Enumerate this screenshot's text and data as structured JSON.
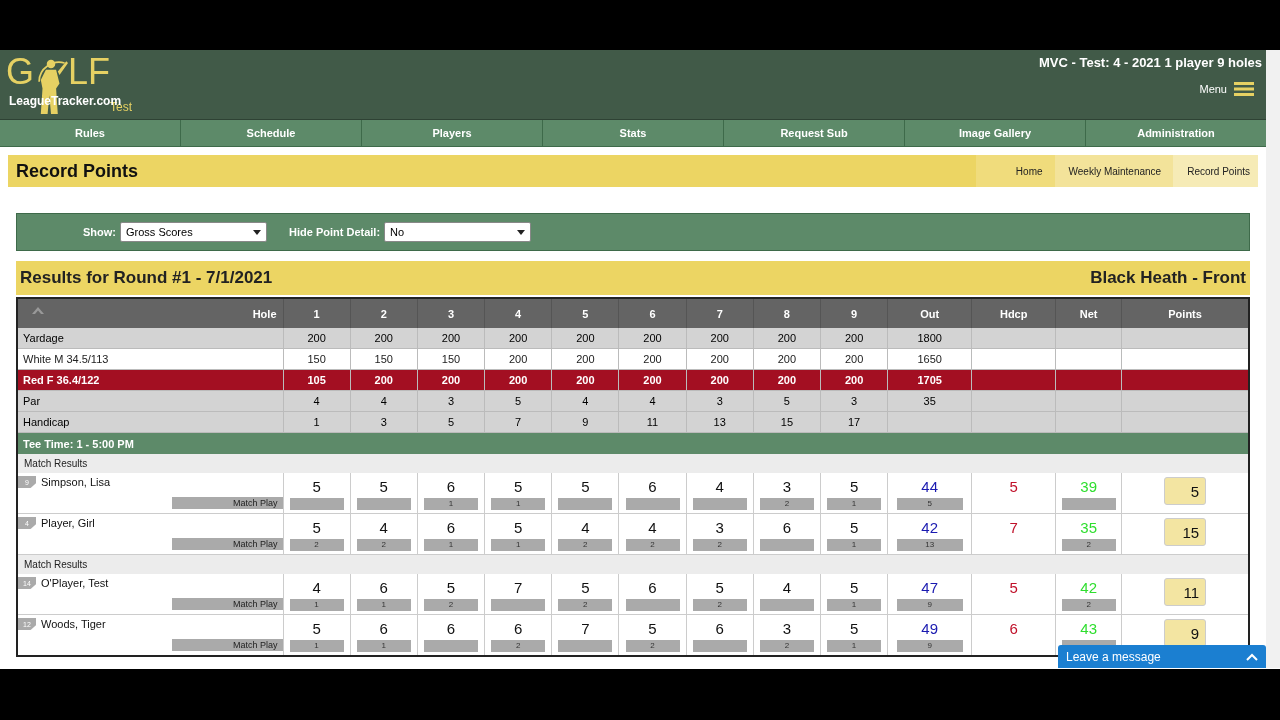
{
  "header": {
    "logo": {
      "left": "G",
      "right": "LF",
      "site": "LeagueTracker.com",
      "tag": "Test"
    },
    "league": "MVC - Test: 4 - 2021 1 player 9 holes",
    "menu": "Menu"
  },
  "nav": [
    "Rules",
    "Schedule",
    "Players",
    "Stats",
    "Request Sub",
    "Image Gallery",
    "Administration"
  ],
  "page_title": "Record Points",
  "breadcrumbs": [
    "Home",
    "Weekly Maintenance",
    "Record Points"
  ],
  "filters": [
    {
      "label": "Show:",
      "value": "Gross Scores"
    },
    {
      "label": "Hide Point Detail:",
      "value": "No"
    }
  ],
  "results": {
    "title": "Results for Round #1 - 7/1/2021",
    "course": "Black Heath - Front"
  },
  "columns": [
    "Hole",
    "1",
    "2",
    "3",
    "4",
    "5",
    "6",
    "7",
    "8",
    "9",
    "Out",
    "Hdcp",
    "Net",
    "Points"
  ],
  "info_rows": [
    {
      "label": "Yardage",
      "kind": "course",
      "cells": [
        "200",
        "200",
        "200",
        "200",
        "200",
        "200",
        "200",
        "200",
        "200",
        "1800"
      ]
    },
    {
      "label": "White M 34.5/113",
      "kind": "tee",
      "color": "#ffffff",
      "cells": [
        "150",
        "150",
        "150",
        "200",
        "200",
        "200",
        "200",
        "200",
        "200",
        "1650"
      ]
    },
    {
      "label": "Red F 36.4/122",
      "kind": "tee",
      "color": "#a30f22",
      "cells": [
        "105",
        "200",
        "200",
        "200",
        "200",
        "200",
        "200",
        "200",
        "200",
        "1705"
      ]
    },
    {
      "label": "Par",
      "kind": "course",
      "cells": [
        "4",
        "4",
        "3",
        "5",
        "4",
        "4",
        "3",
        "5",
        "3",
        "35"
      ]
    },
    {
      "label": "Handicap",
      "kind": "course",
      "cells": [
        "1",
        "3",
        "5",
        "7",
        "9",
        "11",
        "13",
        "15",
        "17"
      ]
    }
  ],
  "tee_time": "Tee Time: 1 - 5:00 PM",
  "groups": [
    {
      "heading": "Match Results",
      "players": [
        {
          "number": "9",
          "name": "Simpson, Lisa",
          "detail": "Match Play",
          "scores": [
            [
              "5"
            ],
            [
              "5"
            ],
            [
              "6",
              "1"
            ],
            [
              "5",
              "1"
            ],
            [
              "5"
            ],
            [
              "6"
            ],
            [
              "4"
            ],
            [
              "3",
              "2"
            ],
            [
              "5",
              "1"
            ]
          ],
          "out": [
            "44",
            "5"
          ],
          "hdcp": "5",
          "net": [
            "39"
          ],
          "points": "5"
        },
        {
          "number": "4",
          "name": "Player, Girl",
          "detail": "Match Play",
          "scores": [
            [
              "5",
              "2"
            ],
            [
              "4",
              "2"
            ],
            [
              "6",
              "1"
            ],
            [
              "5",
              "1"
            ],
            [
              "4",
              "2"
            ],
            [
              "4",
              "2"
            ],
            [
              "3",
              "2"
            ],
            [
              "6"
            ],
            [
              "5",
              "1"
            ]
          ],
          "out": [
            "42",
            "13"
          ],
          "hdcp": "7",
          "net": [
            "35",
            "2"
          ],
          "points": "15"
        }
      ]
    },
    {
      "heading": "Match Results",
      "players": [
        {
          "number": "14",
          "name": "O'Player, Test",
          "detail": "Match Play",
          "scores": [
            [
              "4",
              "1"
            ],
            [
              "6",
              "1"
            ],
            [
              "5",
              "2"
            ],
            [
              "7"
            ],
            [
              "5",
              "2"
            ],
            [
              "6"
            ],
            [
              "5",
              "2"
            ],
            [
              "4"
            ],
            [
              "5",
              "1"
            ]
          ],
          "out": [
            "47",
            "9"
          ],
          "hdcp": "5",
          "net": [
            "42",
            "2"
          ],
          "points": "11"
        },
        {
          "number": "12",
          "name": "Woods, Tiger",
          "detail": "Match Play",
          "scores": [
            [
              "5",
              "1"
            ],
            [
              "6",
              "1"
            ],
            [
              "6"
            ],
            [
              "6",
              "2"
            ],
            [
              "7"
            ],
            [
              "5",
              "2"
            ],
            [
              "6"
            ],
            [
              "3",
              "2"
            ],
            [
              "5",
              "1"
            ]
          ],
          "out": [
            "49",
            "9"
          ],
          "hdcp": "6",
          "net": [
            "43"
          ],
          "points": "9"
        }
      ]
    }
  ],
  "chat": {
    "label": "Leave a message"
  }
}
